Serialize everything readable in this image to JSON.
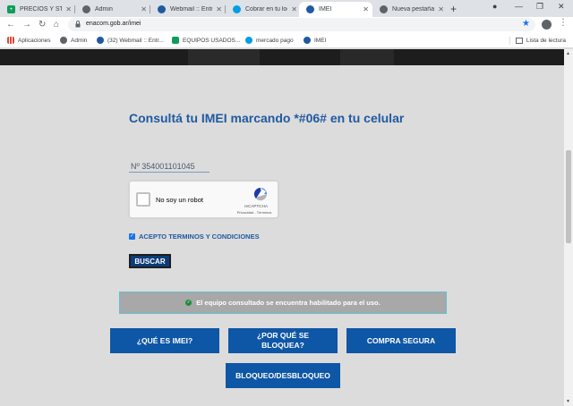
{
  "browser": {
    "tabs": [
      {
        "title": "PRECIOS Y STOC",
        "icon": "sheets-icon",
        "color": "#0f9d58"
      },
      {
        "title": "Admin",
        "icon": "globe-icon",
        "color": "#5f6368"
      },
      {
        "title": "Webmail :: Entra",
        "icon": "webmail-icon",
        "color": "#1f5aa0"
      },
      {
        "title": "Cobrar en tu loc",
        "icon": "mercadopago-icon",
        "color": "#009ee3"
      },
      {
        "title": "IMEI",
        "icon": "enacom-icon",
        "color": "#1f5aa0",
        "active": true
      },
      {
        "title": "Nueva pestaña",
        "icon": "chrome-icon",
        "color": "#5f6368"
      }
    ],
    "url": "enacom.gob.ar/imei",
    "bookmarks": [
      {
        "label": "Aplicaciones",
        "icon": "apps-grid-icon"
      },
      {
        "label": "Admin",
        "icon": "globe-icon"
      },
      {
        "label": "(32) Webmail :: Entr...",
        "icon": "webmail-icon"
      },
      {
        "label": "EQUIPOS USADOS...",
        "icon": "sheets-icon"
      },
      {
        "label": "mercado pago",
        "icon": "mercadopago-icon"
      },
      {
        "label": "IMEI",
        "icon": "enacom-icon"
      }
    ],
    "reading_list": "Lista de lectura"
  },
  "page": {
    "heading": "Consultá tu IMEI marcando *#06# en tu celular",
    "imei_value": "Nº 354001101045",
    "recaptcha": {
      "label": "No soy un robot",
      "brand": "reCAPTCHA",
      "terms": "Privacidad - Términos"
    },
    "accept_label": "ACEPTO TERMINOS Y CONDICIONES",
    "search_button": "BUSCAR",
    "result_message": "El equipo consultado se encuentra habilitado para el uso.",
    "nav_buttons": {
      "what_is": "¿QUÉ ES IMEI?",
      "why_line1": "¿POR QUÉ SE",
      "why_line2": "BLOQUEA?",
      "safe_buy": "COMPRA SEGURA",
      "lock_unlock": "BLOQUEO/DESBLOQUEO"
    }
  },
  "colors": {
    "heading": "#1f5aa0",
    "button": "#0e56a6",
    "result_bg": "#a8a8a8",
    "success": "#1e8e3e"
  }
}
